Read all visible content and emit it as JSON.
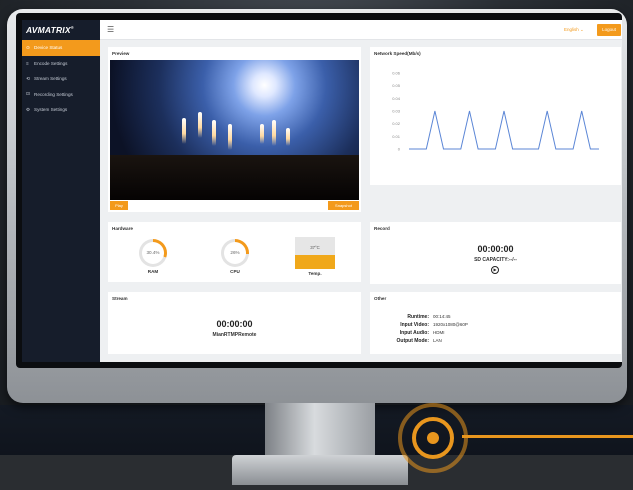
{
  "app": {
    "logo": "AVMATRIX",
    "logo_mark": "®",
    "language": "English ⌄",
    "logout_label": "Logout"
  },
  "sidebar": {
    "items": [
      {
        "label": "Device Status",
        "icon": "gauge-icon",
        "glyph": "⊙",
        "active": true
      },
      {
        "label": "Encode Settings",
        "icon": "sliders-icon",
        "glyph": "≡",
        "active": false
      },
      {
        "label": "Stream Settings",
        "icon": "stream-icon",
        "glyph": "⟲",
        "active": false
      },
      {
        "label": "Recording Settings",
        "icon": "record-icon",
        "glyph": "⊡",
        "active": false
      },
      {
        "label": "System Settings",
        "icon": "gear-icon",
        "glyph": "⚙",
        "active": false
      }
    ]
  },
  "preview": {
    "title": "Preview",
    "play_label": "Play",
    "snapshot_label": "Snapshot"
  },
  "network": {
    "title": "Network Speed(Mb/s)",
    "chart_data": {
      "type": "line",
      "title": "Network Speed(Mb/s)",
      "yticks": [
        "0.06",
        "0.05",
        "0.04",
        "0.03",
        "0.02",
        "0.01",
        "0"
      ],
      "ylim": [
        0,
        0.06
      ],
      "series": [
        {
          "values": [
            0,
            0,
            0,
            0.03,
            0,
            0,
            0,
            0.03,
            0,
            0,
            0,
            0.03,
            0,
            0,
            0,
            0,
            0.03,
            0,
            0,
            0,
            0.03,
            0,
            0
          ]
        }
      ],
      "color": "#5b86d6"
    }
  },
  "hardware": {
    "title": "Hardware",
    "ram": {
      "label": "RAM",
      "value": "30.4%",
      "fraction": 0.304
    },
    "cpu": {
      "label": "CPU",
      "value": "26%",
      "fraction": 0.26
    },
    "temp": {
      "label": "Temp.",
      "value": "37°C",
      "fraction": 0.45
    }
  },
  "record": {
    "title": "Record",
    "time": "00:00:00",
    "sd_capacity": "SD CAPACITY:--/--"
  },
  "stream": {
    "title": "Stream",
    "time": "00:00:00",
    "name": "MianRTMPRemote"
  },
  "other": {
    "title": "Other",
    "rows": [
      {
        "key": "Runtime:",
        "value": "00:14:45"
      },
      {
        "key": "Input Video:",
        "value": "1920x1080@60P"
      },
      {
        "key": "Input Audio:",
        "value": "HDMI"
      },
      {
        "key": "Output Mode:",
        "value": "LAN"
      }
    ]
  },
  "colors": {
    "accent": "#f39a1c",
    "sidebar": "#161d2b",
    "line": "#5b86d6"
  }
}
